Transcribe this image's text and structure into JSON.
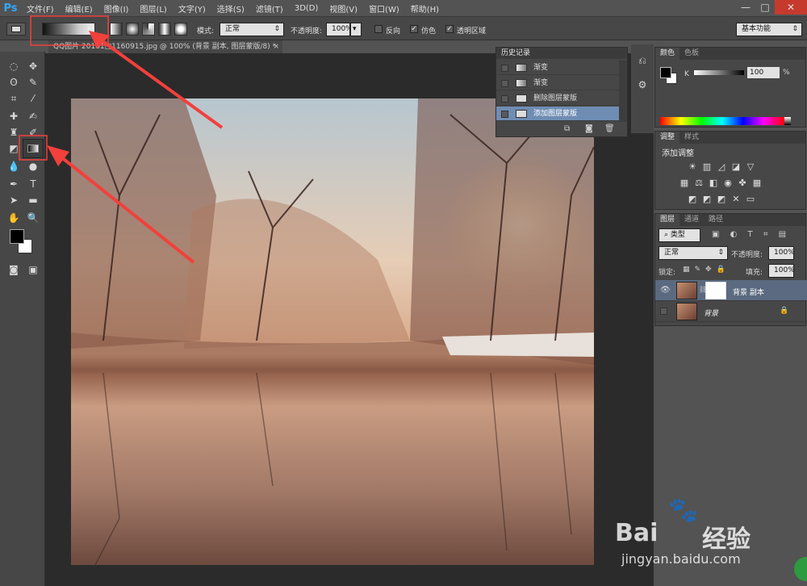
{
  "menubar": {
    "logo": "Ps",
    "items": [
      "文件(F)",
      "编辑(E)",
      "图像(I)",
      "图层(L)",
      "文字(Y)",
      "选择(S)",
      "滤镜(T)",
      "3D(D)",
      "视图(V)",
      "窗口(W)",
      "帮助(H)"
    ],
    "window_controls": [
      "—",
      "□",
      "✕"
    ]
  },
  "options": {
    "mode_label": "模式:",
    "mode_value": "正常",
    "opacity_label": "不透明度:",
    "opacity_value": "100%",
    "reverse_label": "反向",
    "dither_label": "仿色",
    "transparency_label": "透明区域",
    "workspace": "基本功能"
  },
  "document": {
    "tab_title": "QQ图片 20181□1160915.jpg @ 100% (背景 副本, 图层蒙版/8) *",
    "tab_close": "×"
  },
  "history": {
    "title": "历史记录",
    "items": [
      {
        "label": "渐变",
        "selected": false
      },
      {
        "label": "渐变",
        "selected": false
      },
      {
        "label": "删除图层蒙版",
        "selected": false
      },
      {
        "label": "添加图层蒙版",
        "selected": true
      }
    ]
  },
  "color_panel": {
    "tabs": [
      "颜色",
      "色板"
    ],
    "channel": "K",
    "value": "100",
    "unit": "%"
  },
  "adjust_panel": {
    "tabs": [
      "调整",
      "样式"
    ],
    "heading": "添加调整"
  },
  "layers_panel": {
    "tabs": [
      "图层",
      "通道",
      "路径"
    ],
    "filter": "类型",
    "blend_mode": "正常",
    "opacity_label": "不透明度:",
    "opacity_value": "100%",
    "lock_label": "锁定:",
    "fill_label": "填充:",
    "fill_value": "100%",
    "layers": [
      {
        "name": "背景 副本",
        "visible": true,
        "selected": true,
        "has_mask": true
      },
      {
        "name": "背景",
        "visible": false,
        "selected": false,
        "locked": true
      }
    ]
  },
  "watermark": {
    "brand": "Bai",
    "brand2": "经验",
    "url": "jingyan.baidu.com"
  },
  "colors": {
    "accent": "#f2403c",
    "selection": "#6f8db3"
  }
}
